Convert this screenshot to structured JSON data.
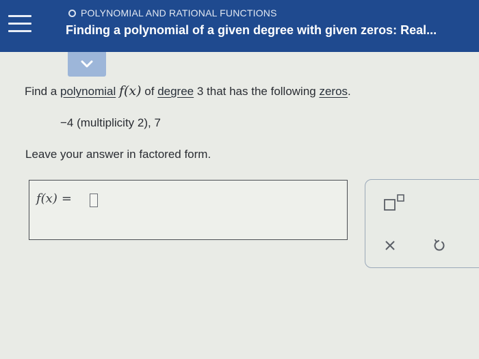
{
  "header": {
    "topic": "POLYNOMIAL AND RATIONAL FUNCTIONS",
    "lesson_title": "Finding a polynomial of a given degree with given zeros: Real..."
  },
  "question": {
    "prefix": "Find a ",
    "term_polynomial": "polynomial",
    "function": "f(x)",
    "of": " of ",
    "term_degree": "degree",
    "degree_value": " 3 that has the following ",
    "term_zeros": "zeros",
    "period": ".",
    "zeros_list": "−4 (multiplicity 2),  7",
    "instruction": "Leave your answer in factored form."
  },
  "answer": {
    "label": "f(x)",
    "equals": "="
  },
  "colors": {
    "header": "#1f4a8f",
    "expand_tab": "#9db6d9",
    "background": "#e9ebe6"
  },
  "icons": {
    "menu": "hamburger-menu-icon",
    "expand": "chevron-down-icon",
    "exponent": "exponent-template-icon",
    "clear": "x-clear-icon",
    "undo": "undo-icon"
  }
}
